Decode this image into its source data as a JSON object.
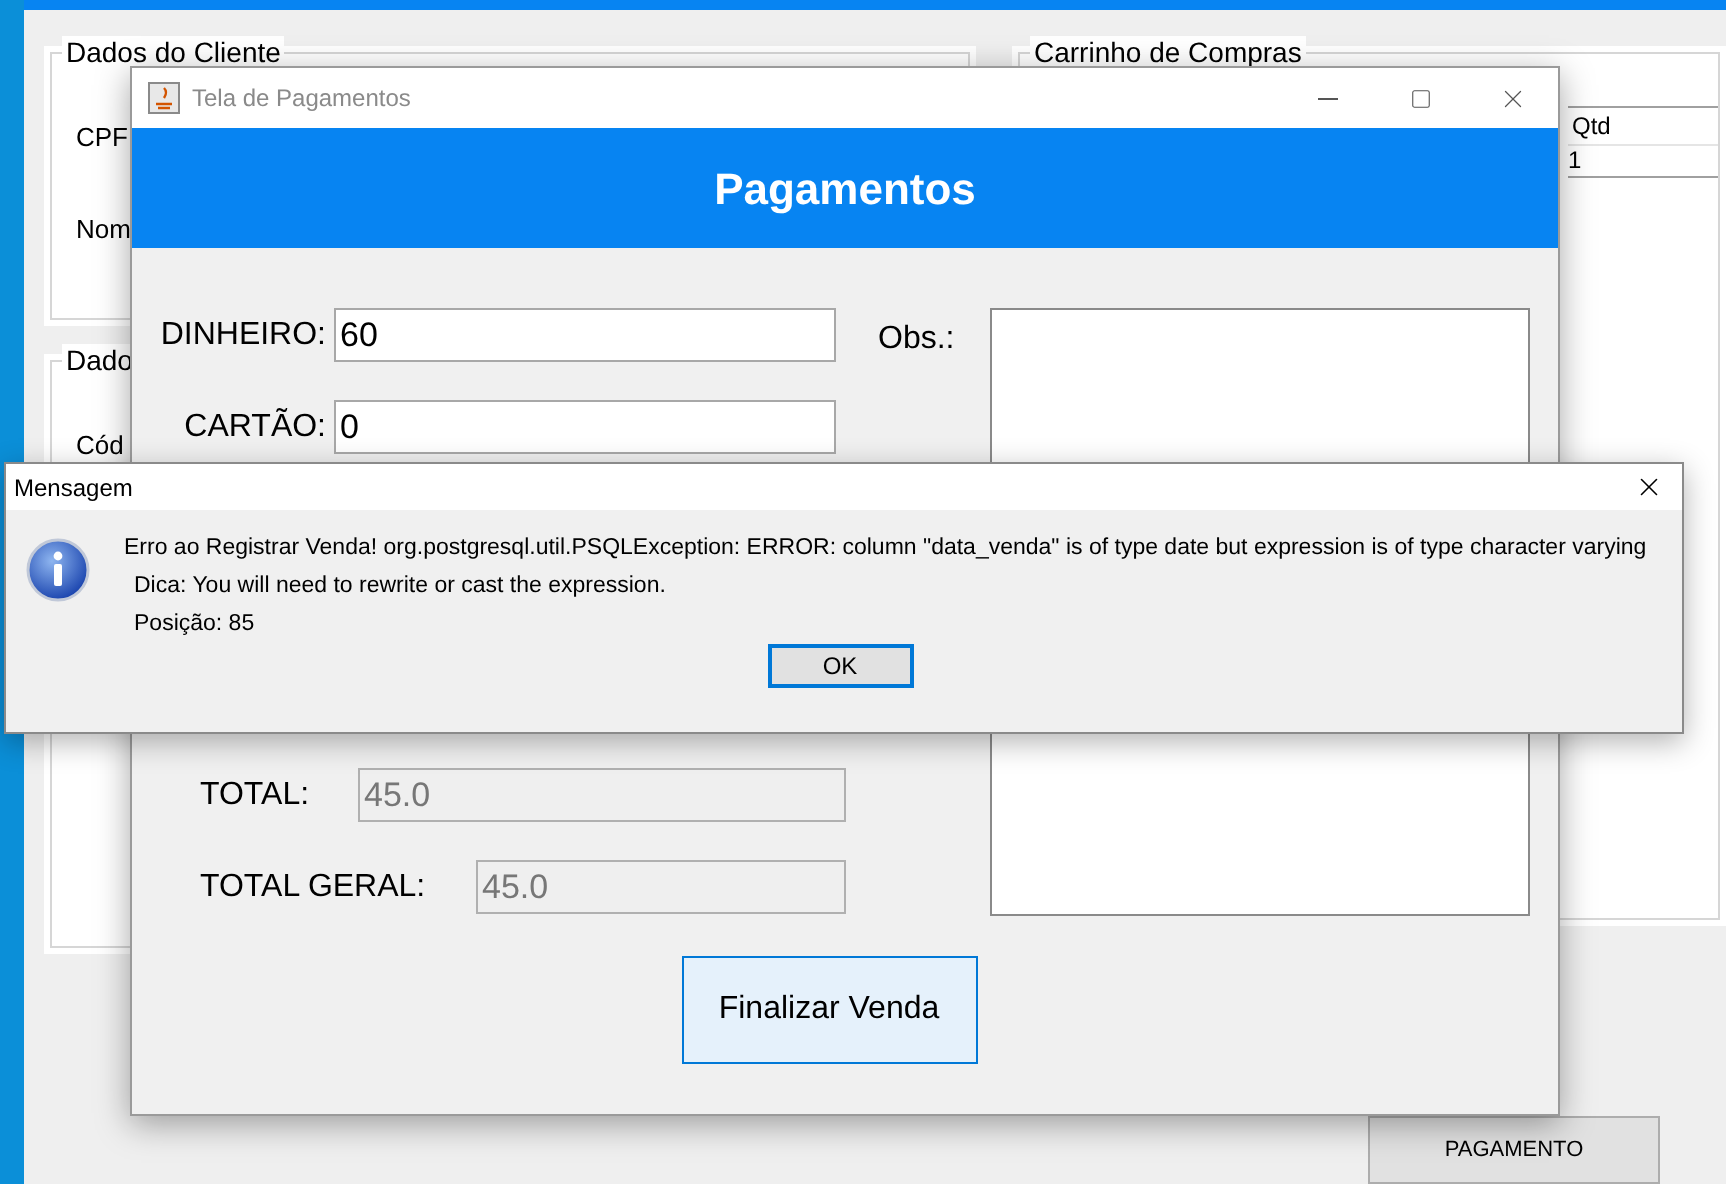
{
  "main_window": {
    "panels": [
      {
        "title": "Dados do Cliente",
        "labels": [
          "CPF",
          "Nom"
        ]
      },
      {
        "title": "Dado",
        "labels": [
          "Cód"
        ]
      }
    ],
    "cart": {
      "title": "Carrinho de Compras",
      "columns": [
        "Qtd"
      ],
      "rows": [
        [
          "1"
        ]
      ]
    },
    "buttons": [
      "PAGAMENTO"
    ]
  },
  "payment_window": {
    "title": "Tela de Pagamentos",
    "header": "Pagamentos",
    "fields": [
      {
        "label": "DINHEIRO:",
        "value": "60",
        "disabled": false
      },
      {
        "label": "CARTÃO:",
        "value": "0",
        "disabled": false
      },
      {
        "label": "TOTAL:",
        "value": "45.0",
        "disabled": true
      },
      {
        "label": "TOTAL GERAL:",
        "value": "45.0",
        "disabled": true
      }
    ],
    "obs_label": "Obs.:",
    "submit": "Finalizar Venda"
  },
  "dialog": {
    "title": "Mensagem",
    "lines": [
      {
        "text": "Erro ao Registrar Venda! org.postgresql.util.PSQLException: ERROR: column \"data_venda\" is of type date but expression is of type character varying",
        "indented": false
      },
      {
        "text": "Dica: You will need to rewrite or cast the expression.",
        "indented": true
      },
      {
        "text": "Posição: 85",
        "indented": true
      }
    ],
    "button": "OK"
  }
}
